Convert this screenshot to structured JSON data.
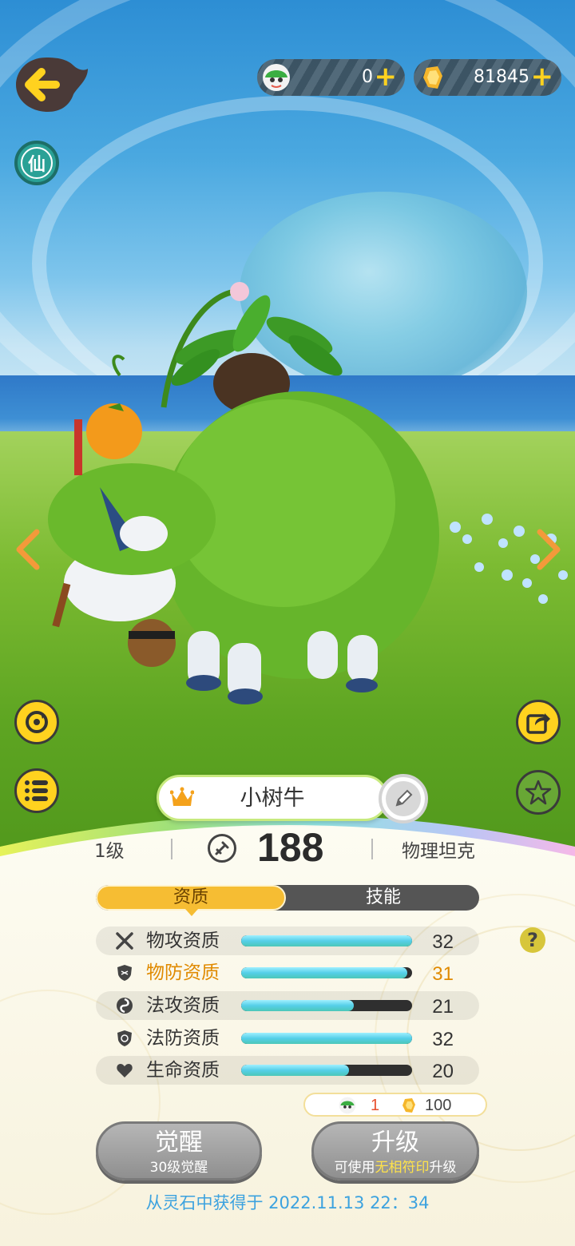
{
  "currency": {
    "gem_value": "0",
    "gold_value": "81845",
    "plus": "+"
  },
  "side": {
    "xian_badge": "仙"
  },
  "pet": {
    "name": "小树牛",
    "level": "1级",
    "power": "188",
    "role": "物理坦克"
  },
  "tabs": {
    "aptitude": "资质",
    "skills": "技能"
  },
  "help_label": "?",
  "attributes": [
    {
      "name": "物攻资质",
      "value": "32",
      "fill": 1.0,
      "highlight": false
    },
    {
      "name": "物防资质",
      "value": "31",
      "fill": 0.97,
      "highlight": true
    },
    {
      "name": "法攻资质",
      "value": "21",
      "fill": 0.66,
      "highlight": false
    },
    {
      "name": "法防资质",
      "value": "32",
      "fill": 1.0,
      "highlight": false
    },
    {
      "name": "生命资质",
      "value": "20",
      "fill": 0.63,
      "highlight": false
    }
  ],
  "cost": {
    "gem_count": "1",
    "gold_count": "100"
  },
  "buttons": {
    "awaken_title": "觉醒",
    "awaken_sub": "30级觉醒",
    "upgrade_title": "升级",
    "upgrade_sub_prefix": "可使用",
    "upgrade_sub_highlight": "无相符印",
    "upgrade_sub_suffix": "升级"
  },
  "footer": "从灵石中获得于 2022.11.13 22：34",
  "colors": {
    "accent_yellow": "#ffd21f",
    "tab_active": "#f6bd33",
    "highlight_orange": "#e08a00",
    "footer_blue": "#3ca2df"
  }
}
